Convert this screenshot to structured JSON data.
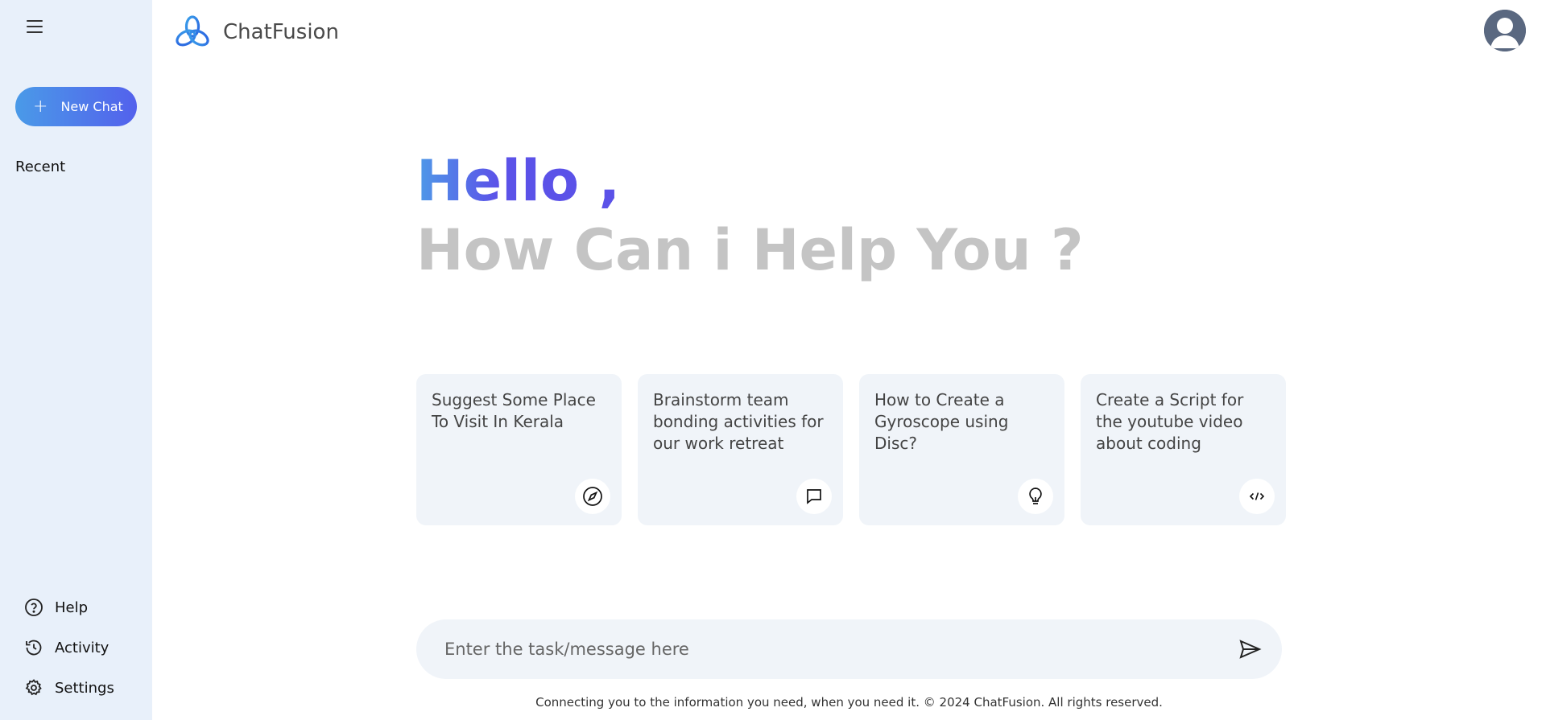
{
  "sidebar": {
    "new_chat_label": "New Chat",
    "recent_label": "Recent",
    "bottom_items": [
      {
        "label": "Help",
        "icon": "help-icon"
      },
      {
        "label": "Activity",
        "icon": "history-icon"
      },
      {
        "label": "Settings",
        "icon": "gear-icon"
      }
    ]
  },
  "header": {
    "app_name": "ChatFusion"
  },
  "greeting": {
    "hello": "Hello ,",
    "subtitle": "How Can i Help You ?"
  },
  "cards": [
    {
      "text": "Suggest Some Place To Visit In Kerala",
      "icon": "compass-icon"
    },
    {
      "text": "Brainstorm team bonding activities for our work retreat",
      "icon": "message-icon"
    },
    {
      "text": "How to Create a Gyroscope using Disc?",
      "icon": "bulb-icon"
    },
    {
      "text": "Create a Script for the youtube video about coding",
      "icon": "code-icon"
    }
  ],
  "input": {
    "placeholder": "Enter the task/message here",
    "value": ""
  },
  "footer": {
    "note": "Connecting you to the information you need, when you need it. © 2024 ChatFusion. All rights reserved."
  },
  "colors": {
    "sidebar_bg": "#e8f0fa",
    "accent_start": "#4a9ae8",
    "accent_end": "#5361ec",
    "card_bg": "#f0f4f9",
    "muted_heading": "#c4c4c4"
  }
}
